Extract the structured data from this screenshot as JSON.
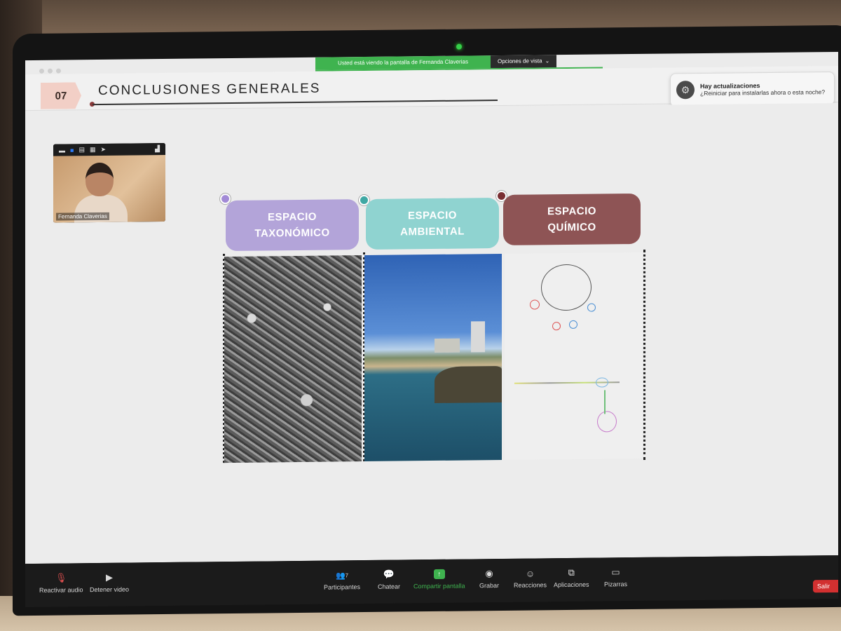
{
  "share_banner": {
    "text": "Usted está viendo la pantalla de Fernanda Claverias",
    "view_options": "Opciones de vista"
  },
  "slide": {
    "section_number": "07",
    "title": "CONCLUSIONES GENERALES",
    "columns": [
      {
        "line1": "ESPACIO",
        "line2": "TAXONÓMICO",
        "color": "#b3a4d9",
        "dot_color": "#a28ad6"
      },
      {
        "line1": "ESPACIO",
        "line2": "AMBIENTAL",
        "color": "#8fd3d0",
        "dot_color": "#3fa8a4"
      },
      {
        "line1": "ESPACIO",
        "line2": "QUÍMICO",
        "color": "#8e5455",
        "dot_color": "#7a2f33"
      }
    ]
  },
  "notification": {
    "title": "Hay actualizaciones",
    "body": "¿Reiniciar para instalarlas ahora o esta noche?",
    "icon": "settings-icon"
  },
  "video": {
    "participant_name": "Fernanda Claverias"
  },
  "toolbar": {
    "audio": "Reactivar audio",
    "video": "Detener video",
    "participants": "Participantes",
    "participants_count": "7",
    "chat": "Chatear",
    "share": "Compartir pantalla",
    "record": "Grabar",
    "reactions": "Reacciones",
    "apps": "Aplicaciones",
    "whiteboards": "Pizarras",
    "leave": "Salir"
  }
}
